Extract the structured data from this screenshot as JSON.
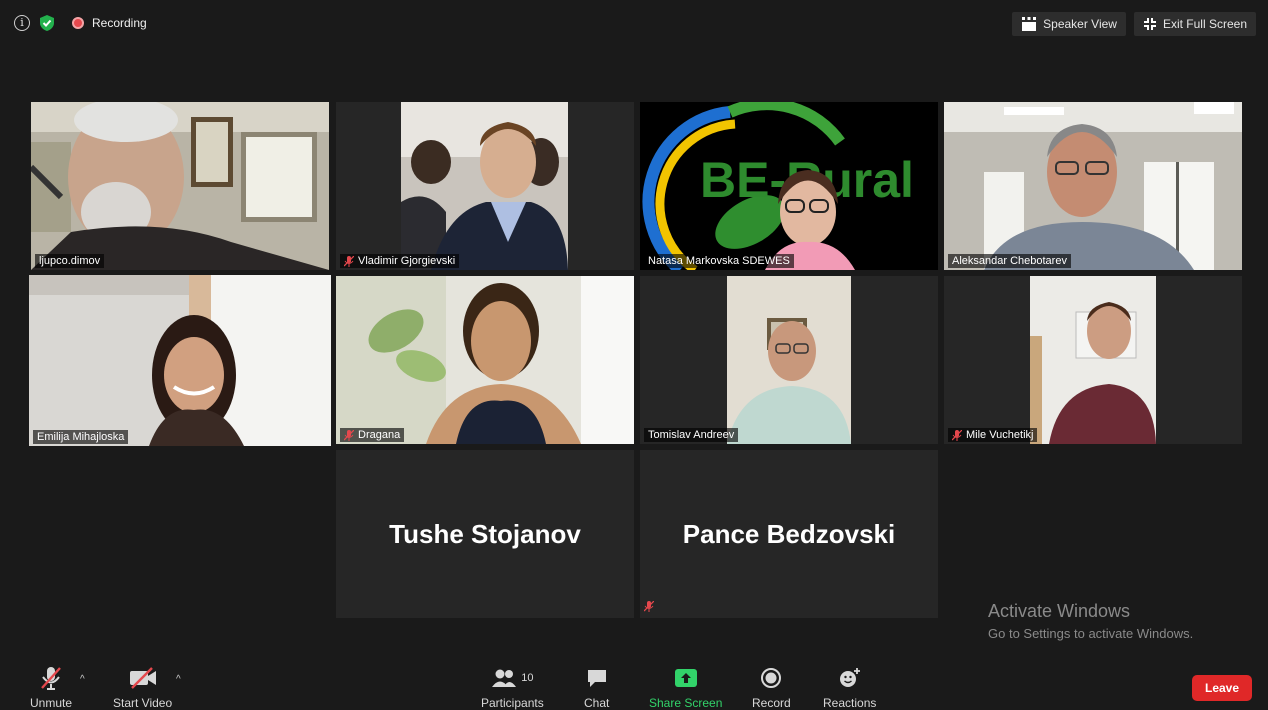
{
  "topbar": {
    "recording_label": "Recording",
    "speaker_view_label": "Speaker View",
    "exit_fullscreen_label": "Exit Full Screen"
  },
  "tiles": [
    {
      "name": "ljupco.dimov",
      "muted": false
    },
    {
      "name": "Vladimir Gjorgievski",
      "muted": true
    },
    {
      "name": "Natasa Markovska SDEWES",
      "muted": false,
      "background_text": "BE-Rural"
    },
    {
      "name": "Aleksandar Chebotarev",
      "muted": false
    },
    {
      "name": "Emilija Mihajloska",
      "muted": false,
      "active_speaker": true
    },
    {
      "name": "Dragana",
      "muted": true
    },
    {
      "name": "Tomislav Andreev",
      "muted": false
    },
    {
      "name": "Mile Vuchetikj",
      "muted": true
    },
    {
      "name": "Tushe Stojanov",
      "muted": false,
      "video_off": true
    },
    {
      "name": "Pance Bedzovski",
      "muted": true,
      "video_off": true
    }
  ],
  "watermark": {
    "title": "Activate Windows",
    "subtitle": "Go to Settings to activate Windows."
  },
  "toolbar": {
    "unmute_label": "Unmute",
    "start_video_label": "Start Video",
    "participants_label": "Participants",
    "participants_count": "10",
    "chat_label": "Chat",
    "share_screen_label": "Share Screen",
    "record_label": "Record",
    "reactions_label": "Reactions",
    "leave_label": "Leave"
  },
  "colors": {
    "background": "#1a1a1a",
    "tile_bg": "#262626",
    "active_speaker_border": "#d9e26b",
    "share_green": "#32d36a",
    "leave_red": "#e02828",
    "mute_red": "#e5484d"
  }
}
